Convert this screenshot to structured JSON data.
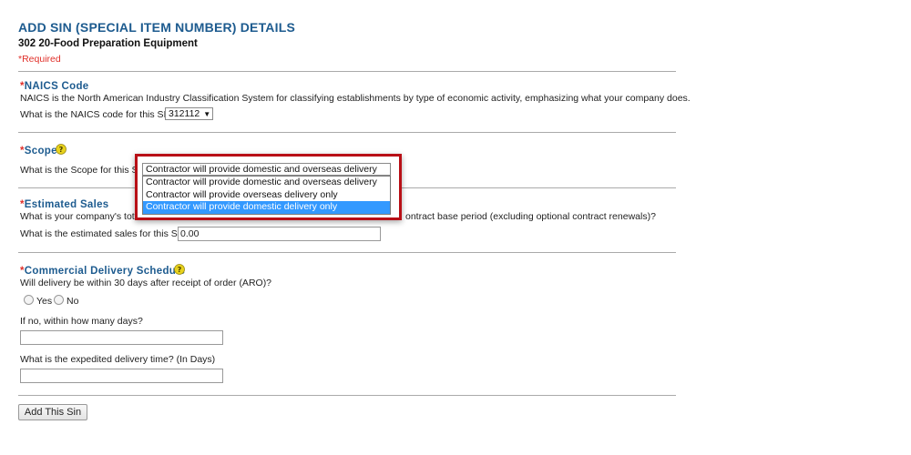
{
  "page": {
    "title": "ADD SIN (SPECIAL ITEM NUMBER) DETAILS",
    "subtitle": "302 20-Food Preparation Equipment",
    "required_note": "*Required"
  },
  "naics": {
    "star": "*",
    "title": "NAICS Code",
    "description": "NAICS is the North American Industry Classification System for classifying establishments by type of economic activity, emphasizing what your company does.",
    "question": "What is the NAICS code for this SIN?",
    "selected": "312112"
  },
  "scope": {
    "star": "*",
    "title": "Scope",
    "question": "What is the Scope for this SIN?",
    "selected": "Contractor will provide domestic and overseas delivery",
    "options": [
      "Contractor will provide domestic and overseas delivery",
      "Contractor will provide overseas delivery only",
      "Contractor will provide domestic delivery only"
    ],
    "highlighted_option_index": 2
  },
  "sales": {
    "star": "*",
    "title": "Estimated Sales",
    "description_visible_left": "What is your company's total",
    "description_visible_right": "ontract base period (excluding optional contract renewals)?",
    "question": "What is the estimated sales for this SIN?",
    "value": "0.00"
  },
  "delivery": {
    "star": "*",
    "title": "Commercial Delivery Schedule",
    "question": "Will delivery be within 30 days after receipt of order (ARO)?",
    "yes_label": "Yes",
    "no_label": "No",
    "days_label": "If no, within how many days?",
    "days_value": "",
    "expedited_label": "What is the expedited delivery time? (In Days)",
    "expedited_value": ""
  },
  "actions": {
    "add_button": "Add This Sin"
  },
  "colors": {
    "heading_blue": "#1d5b8f",
    "required_red": "#e0302a",
    "highlight_frame": "#b80f16",
    "selected_option": "#3399ff"
  },
  "icons": {
    "help": "help-icon"
  }
}
